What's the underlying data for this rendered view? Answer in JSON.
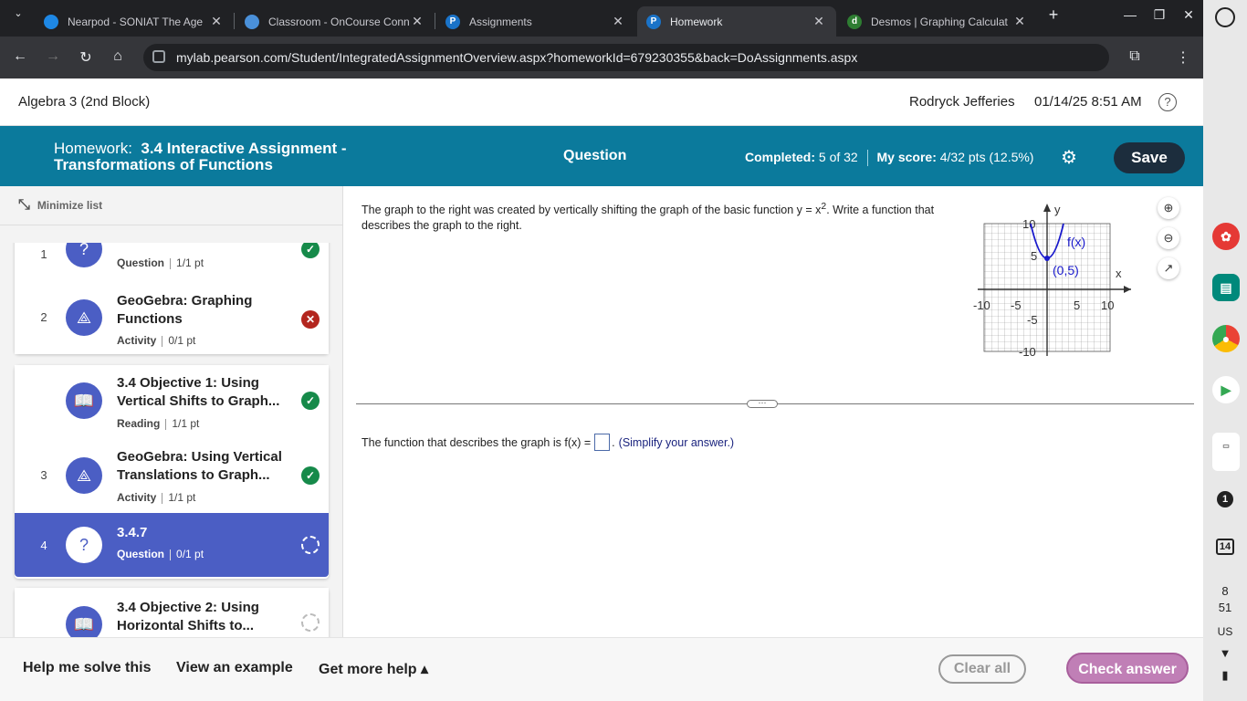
{
  "browser": {
    "tabs": [
      {
        "title": "Nearpod - SONIAT The Age",
        "favicon": "nearpod-icon",
        "color": "#1e88e5",
        "active": false
      },
      {
        "title": "Classroom - OnCourse Conn",
        "favicon": "cloud-icon",
        "color": "#4a90d9",
        "active": false
      },
      {
        "title": "Assignments",
        "favicon": "pearson-icon",
        "color": "#1a73c8",
        "active": false
      },
      {
        "title": "Homework",
        "favicon": "pearson-icon",
        "color": "#1a73c8",
        "active": true
      },
      {
        "title": "Desmos | Graphing Calculat",
        "favicon": "desmos-icon",
        "color": "#2e7d32",
        "active": false
      }
    ],
    "url": "mylab.pearson.com/Student/IntegratedAssignmentOverview.aspx?homeworkId=679230355&back=DoAssignments.aspx"
  },
  "header": {
    "course": "Algebra 3 (2nd Block)",
    "user": "Rodryck Jefferies",
    "datetime": "01/14/25 8:51 AM"
  },
  "band": {
    "hw_prefix": "Homework:",
    "hw_title": "3.4 Interactive Assignment - Transformations of Functions",
    "question_label": "Question",
    "completed_label": "Completed:",
    "completed_value": "5 of 32",
    "score_label": "My score:",
    "score_value": "4/32 pts (12.5%)",
    "save": "Save"
  },
  "sidebar": {
    "minimize": "Minimize list",
    "items": [
      {
        "num": "1",
        "name": "",
        "type": "Question",
        "pts": "1/1 pt",
        "status": "correct",
        "icon": "question-gear-icon"
      },
      {
        "num": "2",
        "name": "GeoGebra: Graphing Functions",
        "type": "Activity",
        "pts": "0/1 pt",
        "status": "incorrect",
        "icon": "shapes-icon"
      },
      {
        "num": "",
        "name": "3.4 Objective 1: Using Vertical Shifts to Graph...",
        "type": "Reading",
        "pts": "1/1 pt",
        "status": "correct",
        "icon": "book-icon"
      },
      {
        "num": "3",
        "name": "GeoGebra: Using Vertical Translations to Graph...",
        "type": "Activity",
        "pts": "1/1 pt",
        "status": "correct",
        "icon": "shapes-icon"
      },
      {
        "num": "4",
        "name": "3.4.7",
        "type": "Question",
        "pts": "0/1 pt",
        "status": "current",
        "icon": "question-gear-icon"
      },
      {
        "num": "",
        "name": "3.4 Objective 2: Using Horizontal Shifts to...",
        "type": "Reading",
        "pts": "",
        "status": "todo",
        "icon": "book-icon"
      }
    ]
  },
  "question": {
    "text_pre": "The graph to the right was created by vertically shifting the graph of the basic function y = x",
    "text_sup": "2",
    "text_post": ". Write a function that describes the graph to the right.",
    "answer_pre": "The function that describes the graph is f(x) =",
    "answer_post": ".",
    "answer_note": "(Simplify your answer.)",
    "answer_value": ""
  },
  "graph": {
    "x_axis_label": "x",
    "y_axis_label": "y",
    "x_ticks": [
      "-10",
      "-5",
      "5",
      "10"
    ],
    "y_ticks": [
      "10",
      "5",
      "-5",
      "-10"
    ],
    "curve_label": "f(x)",
    "point_label": "(0,5)",
    "curve_color": "#1a1acc"
  },
  "footer": {
    "help_solve": "Help me solve this",
    "example": "View an example",
    "more_help": "Get more help ▴",
    "clear": "Clear all",
    "check": "Check answer"
  },
  "shelf": {
    "badge": "1",
    "calendar": "14",
    "hour": "8",
    "minute": "51",
    "locale": "US"
  }
}
